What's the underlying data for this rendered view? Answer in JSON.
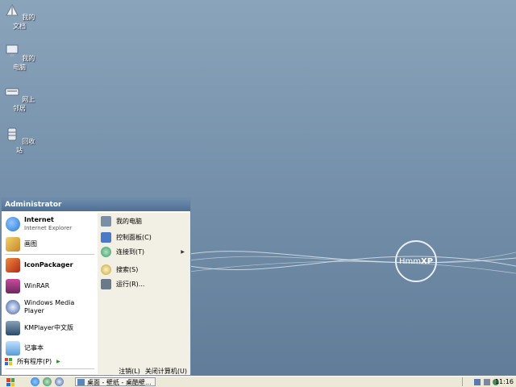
{
  "desktop": {
    "icons": [
      {
        "label": "我的文档",
        "icon": "my-documents-icon"
      },
      {
        "label": "我的电脑",
        "icon": "my-computer-icon"
      },
      {
        "label": "网上邻居",
        "icon": "network-places-icon"
      },
      {
        "label": "回收站",
        "icon": "recycle-bin-icon"
      }
    ],
    "logo": {
      "part1": "Hmm",
      "part2": "XP"
    }
  },
  "start_menu": {
    "user": "Administrator",
    "pinned": [
      {
        "title": "Internet",
        "subtitle": "Internet Explorer",
        "icon": "internet-explorer-icon",
        "color": "#2a7ad6"
      },
      {
        "title": "画图",
        "subtitle": "",
        "icon": "paint-icon",
        "color": "#d9a83a"
      }
    ],
    "programs": [
      {
        "title": "IconPackager",
        "icon": "iconpackager-icon",
        "color": "#c43a2a"
      },
      {
        "title": "WinRAR",
        "icon": "winrar-icon",
        "color": "#8a2e6e"
      },
      {
        "title": "Windows Media Player",
        "icon": "media-player-icon",
        "color": "#3a5fa8"
      },
      {
        "title": "KMPlayer中文版",
        "icon": "kmplayer-icon",
        "color": "#4a6a8a"
      },
      {
        "title": "记事本",
        "icon": "notepad-icon",
        "color": "#5a9ad6"
      }
    ],
    "all_programs": "所有程序(P)",
    "right": [
      {
        "label": "我的电脑",
        "icon": "my-computer-icon",
        "color": "#7a8ea6",
        "arrow": ""
      },
      {
        "label": "控制面板(C)",
        "icon": "control-panel-icon",
        "color": "#4a7ac6",
        "arrow": ""
      },
      {
        "label": "连接到(T)",
        "icon": "connect-to-icon",
        "color": "#3a9a6a",
        "arrow": "▶"
      },
      {
        "label": "搜索(S)",
        "icon": "search-icon",
        "color": "#c6a23a",
        "arrow": ""
      },
      {
        "label": "运行(R)...",
        "icon": "run-icon",
        "color": "#6a7a8a",
        "arrow": ""
      }
    ],
    "logoff": "注销(L)",
    "shutdown": "关闭计算机(U)"
  },
  "taskbar": {
    "task_label": "桌面 - 壁纸 - 桌酷壁...",
    "clock": "11:16"
  },
  "colors": {
    "accent": "#4e6f93",
    "desktop": "#7691ab",
    "taskbar": "#ece9d8"
  }
}
